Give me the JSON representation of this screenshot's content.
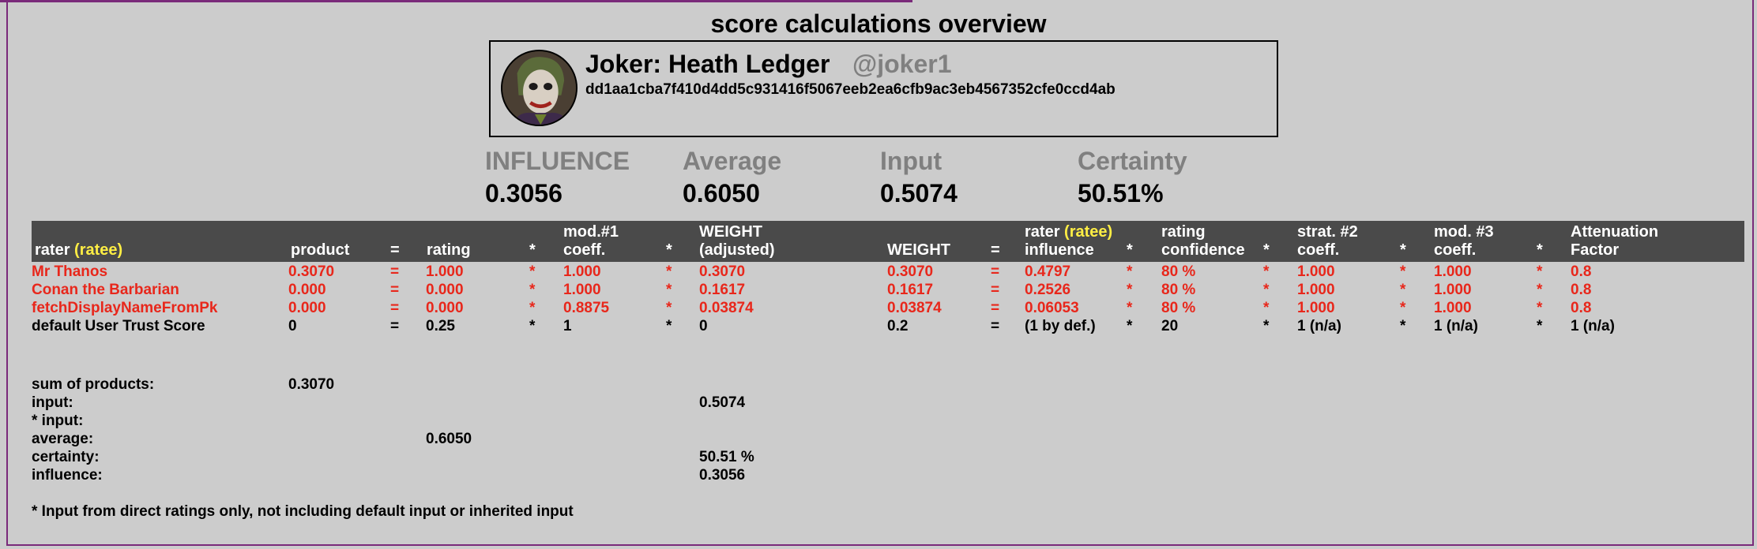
{
  "page": {
    "title": "score calculations overview",
    "frame_color": "#7a2a7a"
  },
  "profile": {
    "name": "Joker: Heath Ledger",
    "handle": "@joker1",
    "pubkey": "dd1aa1cba7f410d4dd5c931416f5067eeb2ea6cfb9ac3eb4567352cfe0ccd4ab",
    "avatar": "avatar-portrait"
  },
  "stats": {
    "influence": {
      "label": "INFLUENCE",
      "value": "0.3056"
    },
    "average": {
      "label": "Average",
      "value": "0.6050"
    },
    "input": {
      "label": "Input",
      "value": "0.5074"
    },
    "certainty": {
      "label": "Certainty",
      "value": "50.51%"
    }
  },
  "table": {
    "header": {
      "rater": "rater ",
      "rater_ratee": "(ratee)",
      "product": "product",
      "eq1": "=",
      "rating": "rating",
      "star1": "*",
      "mod1_line1": "mod.#1",
      "mod1_line2": "coeff.",
      "star2": "*",
      "weight_adj_line1": "WEIGHT",
      "weight_adj_line2": "(adjusted)",
      "weight": "WEIGHT",
      "eq2": "=",
      "rater_infl_line1": "rater ",
      "rater_infl_ratee": "(ratee)",
      "rater_infl_line2": "influence",
      "star3": "*",
      "conf_line1": "rating",
      "conf_line2": "confidence",
      "star4": "*",
      "strat2_line1": "strat. #2",
      "strat2_line2": "coeff.",
      "star5": "*",
      "mod3_line1": "mod. #3",
      "mod3_line2": "coeff.",
      "star6": "*",
      "atten_line1": "Attenuation",
      "atten_line2": "Factor"
    },
    "rows": [
      {
        "rater": "Mr Thanos",
        "product": "0.3070",
        "eq1": "=",
        "rating": "1.000",
        "s1": "*",
        "mod1": "1.000",
        "s2": "*",
        "weight_adj": "0.3070",
        "weight": "0.3070",
        "eq2": "=",
        "influence": "0.4797",
        "s3": "*",
        "confidence": "80 %",
        "s4": "*",
        "strat2": "1.000",
        "s5": "*",
        "mod3": "1.000",
        "s6": "*",
        "atten": "0.8",
        "style": "red"
      },
      {
        "rater": "Conan the Barbarian",
        "product": "0.000",
        "eq1": "=",
        "rating": "0.000",
        "s1": "*",
        "mod1": "1.000",
        "s2": "*",
        "weight_adj": "0.1617",
        "weight": "0.1617",
        "eq2": "=",
        "influence": "0.2526",
        "s3": "*",
        "confidence": "80 %",
        "s4": "*",
        "strat2": "1.000",
        "s5": "*",
        "mod3": "1.000",
        "s6": "*",
        "atten": "0.8",
        "style": "red"
      },
      {
        "rater": "fetchDisplayNameFromPk",
        "product": "0.000",
        "eq1": "=",
        "rating": "0.000",
        "s1": "*",
        "mod1": "0.8875",
        "s2": "*",
        "weight_adj": "0.03874",
        "weight": "0.03874",
        "eq2": "=",
        "influence": "0.06053",
        "s3": "*",
        "confidence": "80 %",
        "s4": "*",
        "strat2": "1.000",
        "s5": "*",
        "mod3": "1.000",
        "s6": "*",
        "atten": "0.8",
        "style": "red"
      },
      {
        "rater": "default User Trust Score",
        "product": "0",
        "eq1": "=",
        "rating": "0.25",
        "s1": "*",
        "mod1": "1",
        "s2": "*",
        "weight_adj": "0",
        "weight": "0.2",
        "eq2": "=",
        "influence": "(1 by def.)",
        "s3": "*",
        "confidence": "20",
        "s4": "*",
        "strat2": "1 (n/a)",
        "s5": "*",
        "mod3": "1 (n/a)",
        "s6": "*",
        "atten": "1 (n/a)",
        "style": "black"
      }
    ]
  },
  "summary": {
    "sum_label": "sum of products:",
    "sum_value": "0.3070",
    "input_label": "input:",
    "input_value": "0.5074",
    "star_input_label": "* input:",
    "average_label": "average:",
    "average_value": "0.6050",
    "certainty_label": "certainty:",
    "certainty_value": "50.51 %",
    "influence_label": "influence:",
    "influence_value": "0.3056",
    "footnote": "* Input from direct ratings only, not including default input or inherited input"
  },
  "colors": {
    "background": "#cccccc",
    "header_bg": "#4a4a4a",
    "accent_red": "#e8271b",
    "accent_yellow": "#ffee44",
    "muted": "#808080"
  }
}
